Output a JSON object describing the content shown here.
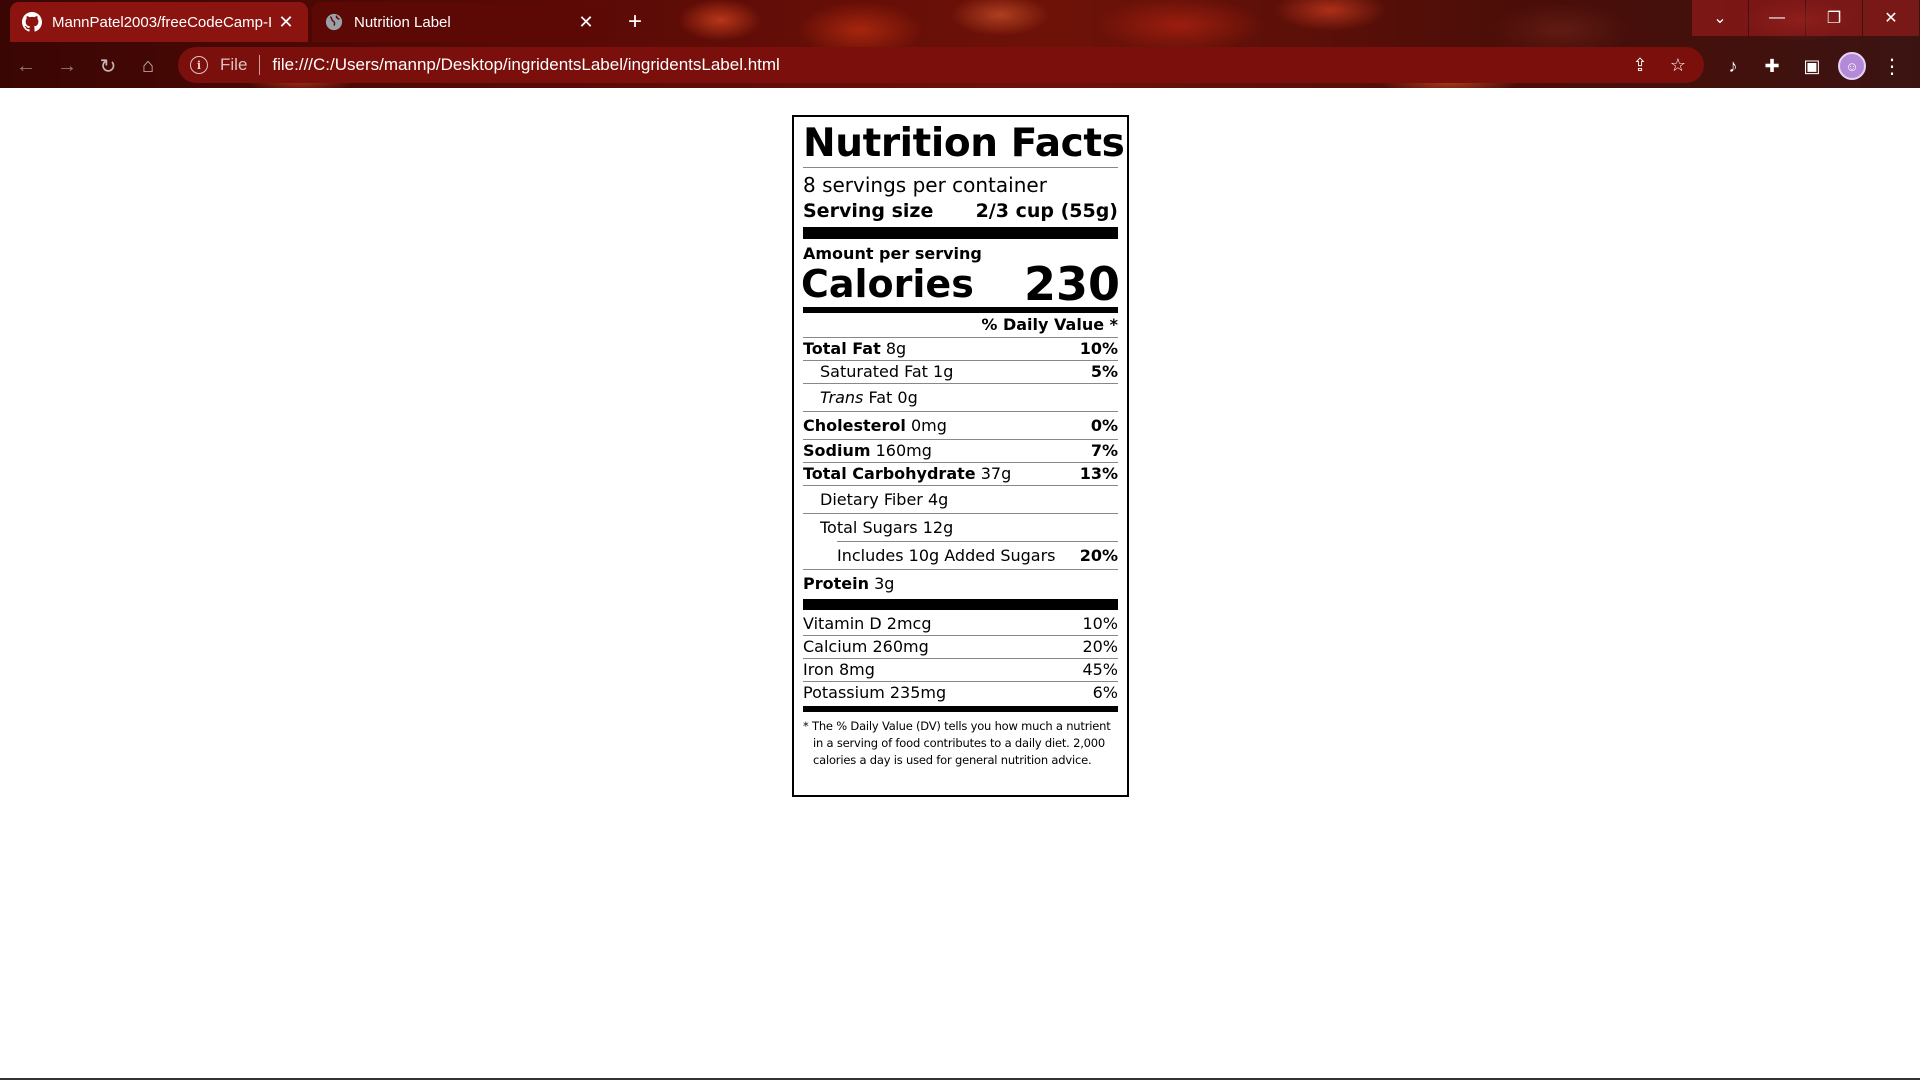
{
  "browser": {
    "tabs": [
      {
        "title": "MannPatel2003/freeCodeCamp-I",
        "favicon": "github-icon",
        "active": false
      },
      {
        "title": "Nutrition Label",
        "favicon": "globe-icon",
        "active": true
      }
    ],
    "address": {
      "scheme_label": "File",
      "url": "file:///C:/Users/mannp/Desktop/ingridentsLabel/ingridentsLabel.html"
    },
    "accent_color": "#7a0f0b"
  },
  "label": {
    "title": "Nutrition Facts",
    "servings": "8 servings per container",
    "serving_size_label": "Serving size",
    "serving_size_value": "2/3 cup (55g)",
    "amount_per_serving": "Amount per serving",
    "calories_label": "Calories",
    "calories_value": "230",
    "daily_value_header": "% Daily Value *",
    "nutrients": [
      {
        "name": "Total Fat",
        "amount": "8g",
        "dv": "10%"
      },
      {
        "name": "Saturated Fat",
        "amount": "1g",
        "dv": "5%"
      },
      {
        "name": "Trans",
        "name_rest": "Fat",
        "amount": "0g",
        "dv": ""
      },
      {
        "name": "Cholesterol",
        "amount": "0mg",
        "dv": "0%"
      },
      {
        "name": "Sodium",
        "amount": "160mg",
        "dv": "7%"
      },
      {
        "name": "Total Carbohydrate",
        "amount": "37g",
        "dv": "13%"
      },
      {
        "name": "Dietary Fiber",
        "amount": "4g",
        "dv": ""
      },
      {
        "name": "Total Sugars",
        "amount": "12g",
        "dv": ""
      },
      {
        "name": "Includes 10g Added Sugars",
        "amount": "",
        "dv": "20%"
      },
      {
        "name": "Protein",
        "amount": "3g",
        "dv": ""
      }
    ],
    "vitamins": [
      {
        "name": "Vitamin D 2mcg",
        "dv": "10%"
      },
      {
        "name": "Calcium 260mg",
        "dv": "20%"
      },
      {
        "name": "Iron 8mg",
        "dv": "45%"
      },
      {
        "name": "Potassium 235mg",
        "dv": "6%"
      }
    ],
    "footnote": "* The % Daily Value (DV) tells you how much a nutrient in a serving of food contributes to a daily diet. 2,000 calories a day is used for general nutrition advice."
  }
}
